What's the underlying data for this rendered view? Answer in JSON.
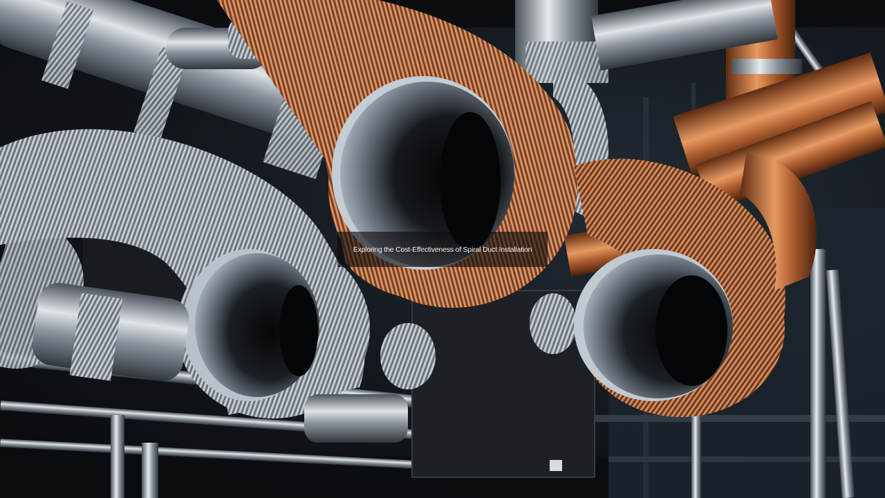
{
  "image": {
    "subject": "spiral-duct-installation-photo",
    "colors": {
      "background_dark": "#0d1014",
      "galvanized_steel": "#9aa3ad",
      "copper": "#b8683a",
      "duct_interior": "#8f9aa6"
    }
  },
  "caption": {
    "text": "Exploring the Cost-Effectiveness of Spiral Duct Installation"
  }
}
